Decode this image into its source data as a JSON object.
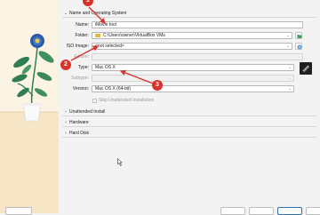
{
  "sections": {
    "name_os": "Name and Operating System",
    "unattended": "Unattended Install",
    "hardware": "Hardware",
    "hard_disk": "Hard Disk"
  },
  "name_row": {
    "label": "Name:",
    "value": "iMovie tool"
  },
  "folder_row": {
    "label": "Folder:",
    "value": "C:\\Users\\owner\\VirtualBox VMs"
  },
  "iso_row": {
    "label": "ISO Image:",
    "value": "<not selected>"
  },
  "edition_row": {
    "label": "Edition:"
  },
  "type_row": {
    "label": "Type:",
    "value": "Mac OS X"
  },
  "subtype_row": {
    "label": "Subtype:"
  },
  "version_row": {
    "label": "Version:",
    "value": "Mac OS X (64-bit)"
  },
  "skip_unattended": {
    "label": "Skip Unattended Installation"
  },
  "annotations": [
    "1",
    "2",
    "3"
  ],
  "colors": {
    "accent_red": "#d9322b",
    "side_panel": "#fbf3e3",
    "leaf_green": "#2f7d53",
    "flower_blue": "#2c5aa8"
  }
}
